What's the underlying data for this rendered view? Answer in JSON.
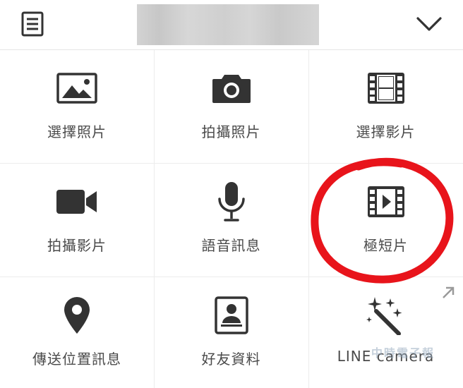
{
  "header": {
    "menu_icon": "notes-icon",
    "title": "",
    "expand_icon": "chevron-down-icon"
  },
  "grid": {
    "items": [
      {
        "label": "選擇照片",
        "icon": "image-icon"
      },
      {
        "label": "拍攝照片",
        "icon": "camera-icon"
      },
      {
        "label": "選擇影片",
        "icon": "film-icon"
      },
      {
        "label": "拍攝影片",
        "icon": "video-camera-icon"
      },
      {
        "label": "語音訊息",
        "icon": "microphone-icon"
      },
      {
        "label": "極短片",
        "icon": "film-play-icon"
      },
      {
        "label": "傳送位置訊息",
        "icon": "location-pin-icon"
      },
      {
        "label": "好友資料",
        "icon": "contact-book-icon"
      },
      {
        "label": "LINE camera",
        "icon": "magic-wand-icon"
      }
    ]
  },
  "watermark": {
    "text": "中時電子報"
  },
  "colors": {
    "icon": "#333333",
    "label": "#4a4a4a",
    "annotation": "#e8141b",
    "divider": "#ececec"
  }
}
